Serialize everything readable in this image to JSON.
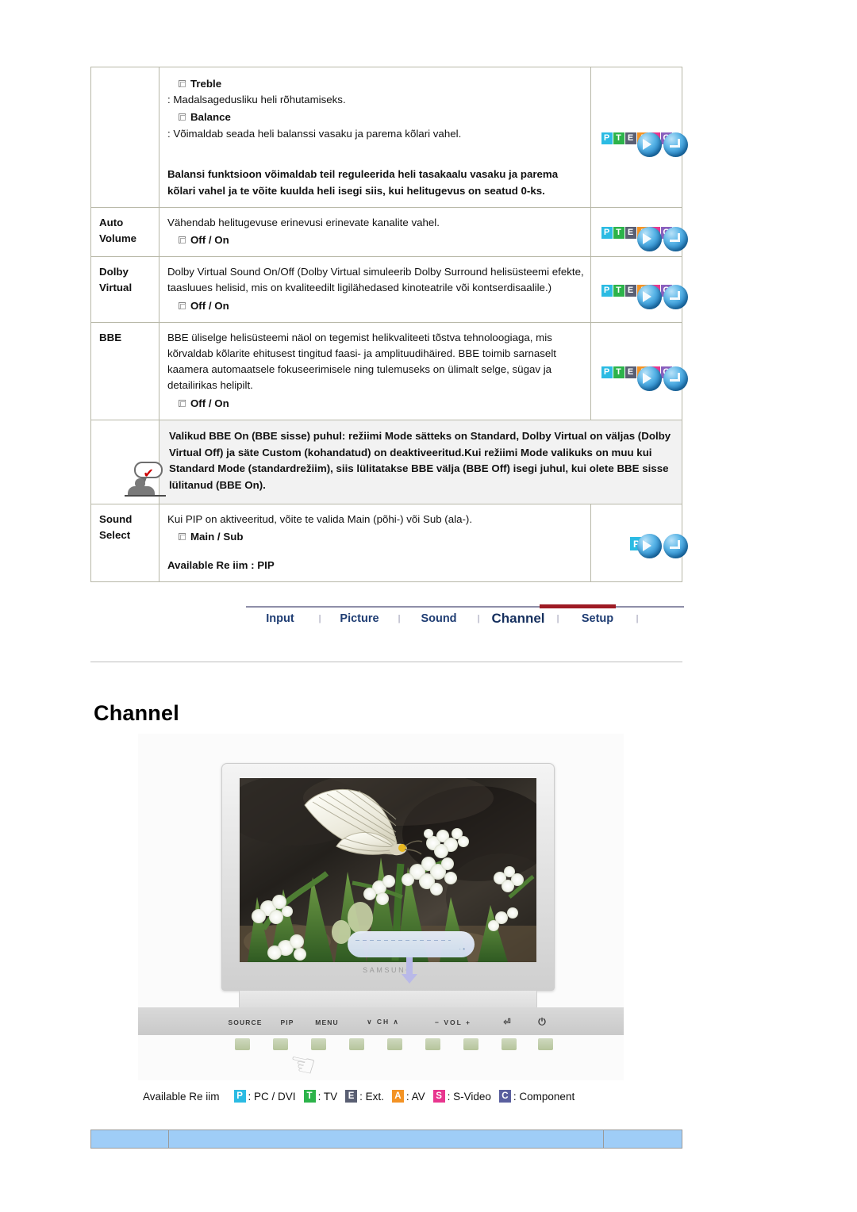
{
  "table": {
    "rows": [
      {
        "label": "",
        "items": [
          {
            "type": "bullet",
            "text": "Treble"
          },
          {
            "type": "plain",
            "text": ": Madalsagedusliku heli rõhutamiseks."
          },
          {
            "type": "bullet",
            "text": "Balance"
          },
          {
            "type": "plain",
            "text": ": Võimaldab seada heli balanssi vasaku ja parema kõlari vahel."
          },
          {
            "type": "boldblock",
            "text": "Balansi funktsioon võimaldab teil reguleerida heli tasakaalu vasaku ja parema kõlari vahel ja te võite kuulda heli isegi siis, kui helitugevus on seatud 0-ks."
          }
        ],
        "icon": "pteasc"
      },
      {
        "label": "Auto\nVolume",
        "items": [
          {
            "type": "plain",
            "text": "Vähendab helitugevuse erinevusi erinevate kanalite vahel."
          },
          {
            "type": "bullet",
            "text": "Off / On"
          }
        ],
        "icon": "pteasc"
      },
      {
        "label": "Dolby\nVirtual",
        "items": [
          {
            "type": "plain",
            "text": "Dolby Virtual Sound On/Off (Dolby Virtual simuleerib Dolby Surround helisüsteemi efekte, taasluues helisid, mis on kvaliteedilt ligilähedased kinoteatrile või kontserdisaalile.)"
          },
          {
            "type": "bullet",
            "text": "Off / On"
          }
        ],
        "icon": "pteasc"
      },
      {
        "label": "BBE",
        "items": [
          {
            "type": "plain",
            "text": "BBE üliselge helisüsteemi näol on tegemist helikvaliteeti tõstva tehnoloogiaga, mis kõrvaldab kõlarite ehitusest tingitud faasi- ja amplituudihäired. BBE toimib sarnaselt kaamera automaatsele fokuseerimisele ning tulemuseks on ülimalt selge, sügav ja detailirikas helipilt."
          },
          {
            "type": "bullet",
            "text": "Off / On"
          }
        ],
        "icon": "pteasc"
      }
    ],
    "note": {
      "icon_name": "note-person-icon",
      "text": "Valikud BBE On (BBE sisse) puhul: režiimi Mode sätteks on Standard, Dolby Virtual on väljas (Dolby Virtual Off) ja säte Custom (kohandatud) on deaktiveeritud.Kui režiimi Mode valikuks on muu kui Standard Mode (standardrežiim), siis lülitatakse BBE välja (BBE Off) isegi juhul, kui olete BBE sisse lülitanud (BBE On)."
    },
    "sound_select": {
      "label": "Sound\nSelect",
      "desc": "Kui PIP on aktiveeritud, võite te valida Main (põhi-) või Sub (ala-).",
      "bullet": "Main / Sub",
      "available": "Available Re  iim : PIP",
      "icon_badge": "P"
    },
    "badges": [
      {
        "letter": "P",
        "color": "#2bbbe3"
      },
      {
        "letter": "T",
        "color": "#2cb34a"
      },
      {
        "letter": "E",
        "color": "#5a5f73"
      },
      {
        "letter": "A",
        "color": "#f39325"
      },
      {
        "letter": "S",
        "color": "#e8368f"
      },
      {
        "letter": "C",
        "color": "#8a5fbe"
      }
    ]
  },
  "nav": {
    "items": [
      {
        "label": "Input",
        "active": false
      },
      {
        "label": "Picture",
        "active": false
      },
      {
        "label": "Sound",
        "active": false
      },
      {
        "label": "Channel",
        "active": true
      },
      {
        "label": "Setup",
        "active": false
      }
    ],
    "separator": "|",
    "active_color": "#9e1b24",
    "link_color": "#1f3d73"
  },
  "page_title": "Channel",
  "figure": {
    "brand": "SAMSUNG",
    "controls": {
      "source": "SOURCE",
      "pip": "PIP",
      "menu": "MENU",
      "channel": "∨  CH  ∧",
      "volume": "−   VOL  +",
      "enter": "⏎",
      "power": "⏻"
    }
  },
  "legend": {
    "label": "Available Re  iim",
    "entries": [
      {
        "letter": "P",
        "color": "#2bbbe3",
        "text": ": PC / DVI"
      },
      {
        "letter": "T",
        "color": "#2cb34a",
        "text": ": TV"
      },
      {
        "letter": "E",
        "color": "#5a5f73",
        "text": ": Ext."
      },
      {
        "letter": "A",
        "color": "#f39325",
        "text": ": AV"
      },
      {
        "letter": "S",
        "color": "#e8368f",
        "text": ": S-Video"
      },
      {
        "letter": "C",
        "color": "#5a5f9e",
        "text": ": Component"
      }
    ]
  },
  "footer": {
    "bar_color": "#9fcdf7",
    "cells": [
      "",
      "",
      ""
    ]
  }
}
